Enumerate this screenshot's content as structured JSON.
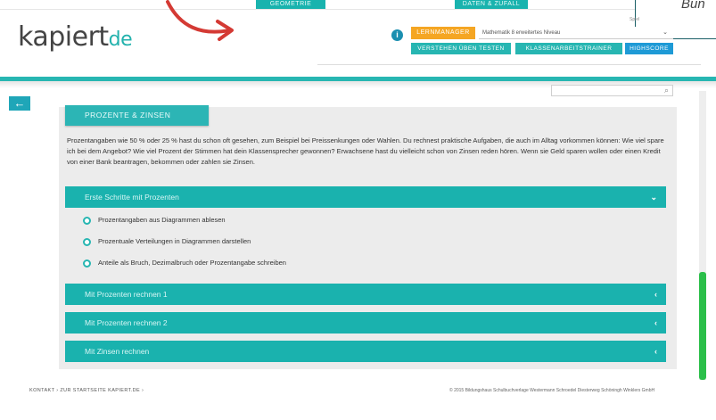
{
  "top_tabs": [
    "GEOMETRIE",
    "DATEN & ZUFALL"
  ],
  "callout_text": "Bun",
  "logo": {
    "main": "kapiert",
    "suffix": "de"
  },
  "header": {
    "info_label": "i",
    "lernmanager_label": "LERNMANAGER",
    "course_select": "Mathematik 8 erweitertes Niveau",
    "nav": [
      "VERSTEHEN ÜBEN TESTEN",
      "KLASSENARBEITSTRAINER",
      "HIGHSCORE"
    ],
    "small_text": "Spiel"
  },
  "back_icon": "←",
  "section": {
    "title": "PROZENTE & ZINSEN",
    "intro": "Prozentangaben wie 50 % oder 25 % hast du schon oft gesehen, zum Beispiel bei Preissenkungen oder Wahlen. Du rechnest praktische Aufgaben, die auch im Alltag vorkommen können: Wie viel spare ich bei dem Angebot? Wie viel Prozent der Stimmen hat dein Klassensprecher gewonnen? Erwachsene hast du vielleicht schon von Zinsen reden hören. Wenn sie Geld sparen wollen oder einen Kredit von einer Bank beantragen, bekommen oder zahlen sie Zinsen."
  },
  "accordion": [
    {
      "label": "Erste Schritte mit Prozenten",
      "icon": "⌄",
      "items": [
        "Prozentangaben aus Diagrammen ablesen",
        "Prozentuale Verteilungen in Diagrammen darstellen",
        "Anteile als Bruch, Dezimalbruch oder Prozentangabe schreiben"
      ]
    },
    {
      "label": "Mit Prozenten rechnen 1",
      "icon": "‹"
    },
    {
      "label": "Mit Prozenten rechnen 2",
      "icon": "‹"
    },
    {
      "label": "Mit Zinsen rechnen",
      "icon": "‹"
    }
  ],
  "footer": {
    "left": "KONTAKT ›   ZUR STARTSEITE KAPIERT.DE ›",
    "right": "© 2015 Bildungshaus Schulbuchverlage Westermann Schroedel Diesterweg Schöningh Winklers GmbH"
  },
  "colors": {
    "teal": "#1ab2ae",
    "orange": "#f5a623",
    "blue": "#1e9ad6",
    "arrow_red": "#d43a34"
  }
}
